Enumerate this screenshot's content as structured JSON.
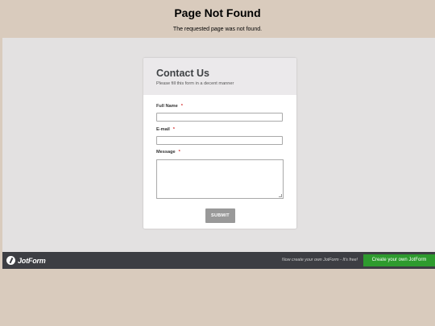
{
  "error": {
    "title": "Page Not Found",
    "message": "The requested page was not found."
  },
  "form": {
    "title": "Contact Us",
    "subtitle": "Please fill this form in a decent manner",
    "required_marker": "*",
    "fields": [
      {
        "label": "Full Name",
        "value": "",
        "required": true
      },
      {
        "label": "E-mail",
        "value": "",
        "required": true
      },
      {
        "label": "Message",
        "value": "",
        "required": true
      }
    ],
    "submit_label": "SUBMIT"
  },
  "footer": {
    "logo_text": "JotForm",
    "logo_icon": "jotform-pencil-icon",
    "promo_text": "Now create your own JotForm - It's free!",
    "cta_label": "Create your own JotForm"
  },
  "colors": {
    "page_background": "#d9cbbd",
    "frame_background": "#e3e1e1",
    "footer_background": "#3d3e43",
    "cta_background": "#2e9b2e",
    "submit_background": "#999999",
    "required_marker": "#d42a2a"
  }
}
